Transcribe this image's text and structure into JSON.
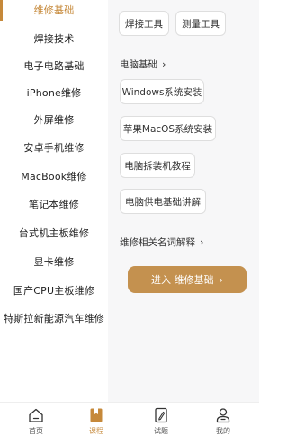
{
  "colors": {
    "accent": "#c6893a",
    "button": "#c4914f",
    "content_bg": "#f7f7f8"
  },
  "sidebar": {
    "items": [
      {
        "label": "维修基础",
        "active": true
      },
      {
        "label": "焊接技术"
      },
      {
        "label": "电子电路基础"
      },
      {
        "label": "iPhone维修"
      },
      {
        "label": "外屏维修"
      },
      {
        "label": "安卓手机维修"
      },
      {
        "label": "MacBook维修"
      },
      {
        "label": "笔记本维修"
      },
      {
        "label": "台式机主板维修"
      },
      {
        "label": "显卡维修"
      },
      {
        "label": "国产CPU主板维修"
      },
      {
        "label": "特斯拉新能源汽车维修"
      }
    ]
  },
  "content": {
    "top_chips": [
      "焊接工具",
      "测量工具"
    ],
    "computer_section": {
      "title": "电脑基础",
      "chips": [
        "Windows系统安装",
        "苹果MacOS系统安装",
        "电脑拆装机教程",
        "电脑供电基础讲解"
      ]
    },
    "terms_section": {
      "title": "维修相关名词解释"
    },
    "enter_button": {
      "label": "进入 维修基础"
    }
  },
  "tabbar": {
    "tabs": [
      {
        "label": "首页",
        "icon": "home-icon"
      },
      {
        "label": "课程",
        "icon": "course-book-icon",
        "active": true
      },
      {
        "label": "试题",
        "icon": "quiz-icon"
      },
      {
        "label": "我的",
        "icon": "profile-icon"
      }
    ]
  }
}
